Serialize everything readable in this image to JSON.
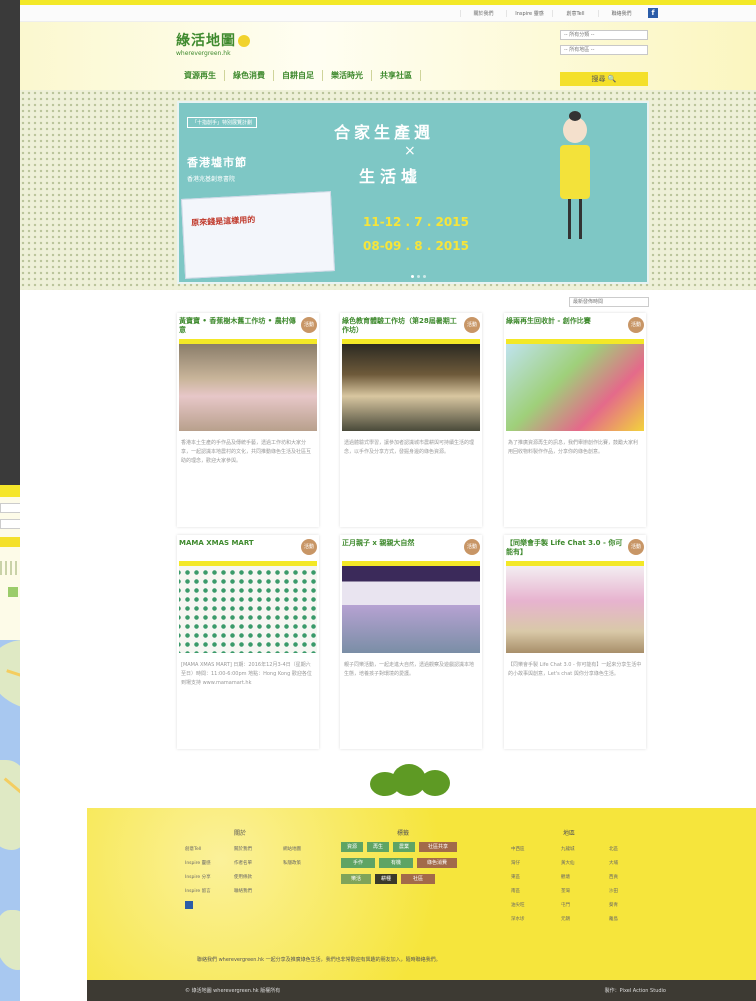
{
  "topbar": {
    "links": [
      "關於我們",
      "Inspire 靈感",
      "創意Tell",
      "聯絡我們"
    ],
    "fb": "f"
  },
  "logo": {
    "cn": "綠活地圖",
    "en": "wherevergreen.hk"
  },
  "nav": [
    "資源再生",
    "綠色消費",
    "自耕自足",
    "樂活時光",
    "共享社區"
  ],
  "search": {
    "select1": "-- 所有分類 --",
    "select2": "-- 所有地區 --",
    "button": "搜尋 🔍"
  },
  "banner": {
    "tag": "「十指創手」特別展覽計劃",
    "left_title": "香港墟市節",
    "left_sub": "香港兆基創意書院",
    "poster_text": "原來錢是這樣用的",
    "title": "合家生產週",
    "x": "×",
    "sub": "生活墟",
    "date1": "11-12 . 7 . 2015",
    "date2": "08-09 . 8 . 2015"
  },
  "sort": "最新發佈時間",
  "cards": [
    {
      "title": "黃寶寶 • 香蕉樹木舊工作坊 • 農村傳意",
      "badge": "活動",
      "text": "香港本土生產的手作品及傳統手藝，透過工作坊和大家分享，一起認識本地農村的文化，共同推動綠色生活及社區互助的理念，歡迎大家參與。"
    },
    {
      "title": "綠色教育體驗工作坊（第28屆暑期工作坊）",
      "badge": "活動",
      "text": "透過體驗式學習，讓參加者認識城市農耕與可持續生活的理念，以手作及分享方式，發掘身邊的綠色資源。"
    },
    {
      "title": "綠兩再生回收計 - 創作比賽",
      "badge": "活動",
      "text": "為了推廣資源再生的訊息，我們舉辦創作比賽，鼓勵大家利用回收物料製作作品，分享你的綠色創意。"
    },
    {
      "title": "MAMA XMAS MART",
      "badge": "活動",
      "text": "[MAMA XMAS MART] 日期：2016年12月3-4日（星期六至日）時間：11:00-6:00pm 地點：Hong Kong 歡迎各位到場支持 www.mamamart.hk"
    },
    {
      "title": "正月親子 x 親親大自然",
      "badge": "活動",
      "text": "親子同樂活動，一起走進大自然，透過觀察及遊戲認識本地生態，培養孩子對環境的愛護。"
    },
    {
      "title": "【同樂會手製 Life Chat 3.0 - 你可能有】",
      "badge": "活動",
      "text": "【同樂會手製 Life Chat 3.0 - 你可能有】一起來分享生活中的小故事與創意，Let's chat 與你分享綠色生活。"
    }
  ],
  "footer": {
    "col1": "關於",
    "col1_links": [
      "創意Tell",
      "Inspire 靈感",
      "Inspire 分享",
      "Inspire 留言",
      "關於我們",
      "作者名單",
      "使用條款",
      "聯絡我們",
      "網站地圖",
      "私隱政策"
    ],
    "col2": "標籤",
    "tags": [
      "資源",
      "再生",
      "農業",
      "社區共享",
      "手作",
      "有機",
      "綠色消費",
      "樂活",
      "耕種",
      "社區",
      "飲食",
      "家居"
    ],
    "col3": "地區",
    "col3_links": [
      "中西區",
      "灣仔",
      "東區",
      "南區",
      "油尖旺",
      "深水埗",
      "九龍城",
      "黃大仙",
      "觀塘",
      "荃灣",
      "屯門",
      "元朗",
      "北區",
      "大埔",
      "西貢",
      "沙田",
      "葵青",
      "離島"
    ],
    "note": "聯絡我們 wherevergreen.hk 一起分享及推廣綠色生活，我們也非常歡迎有興趣的朋友加入，隨時聯絡我們。"
  },
  "bottom": {
    "left": "© 綠活地圖 wherevergreen.hk 版權所有",
    "right": "製作：Pixel Action Studio"
  },
  "colors": {
    "yellow": "#f3e827",
    "green": "#3f8a2e",
    "teal": "#7ec7c5",
    "badge": "#c89666"
  }
}
